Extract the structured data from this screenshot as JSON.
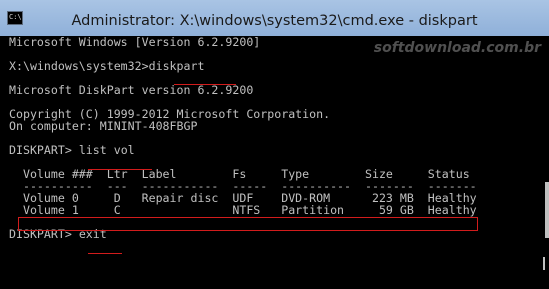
{
  "window": {
    "title": "Administrator: X:\\windows\\system32\\cmd.exe - diskpart",
    "icon": "C:\\"
  },
  "watermark": "softdownload.com.br",
  "console": {
    "line1": "Microsoft Windows [Version 6.2.9200]",
    "prompt1": "X:\\windows\\system32>",
    "cmd1": "diskpart",
    "version": "Microsoft DiskPart version 6.2.9200",
    "copyright": "Copyright (C) 1999-2012 Microsoft Corporation.",
    "computer": "On computer: MININT-408FBGP",
    "prompt2": "DISKPART> ",
    "cmd2": "list vol",
    "table_header": "  Volume ###  Ltr  Label        Fs     Type        Size     Status",
    "table_sep": "  ----------  ---  -----------  -----  ----------  -------  -------",
    "rows": [
      "  Volume 0     D   Repair disc  UDF    DVD-ROM      223 MB  Healthy",
      "  Volume 1     C                NTFS   Partition     59 GB  Healthy"
    ],
    "prompt3": "DISKPART> ",
    "cmd3": "exit"
  }
}
